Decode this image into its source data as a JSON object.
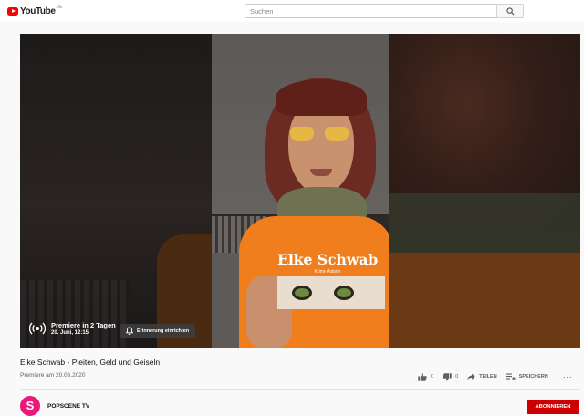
{
  "header": {
    "logo_text": "YouTube",
    "region": "DE",
    "search_placeholder": "Suchen"
  },
  "player": {
    "premiere_title": "Premiere in 2 Tagen",
    "premiere_date": "20. Juni, 12:15",
    "reminder_label": "Erinnerung einrichten",
    "shirt_text": "Elke Schwab",
    "shirt_subtext": "Krimi-Autorin"
  },
  "video": {
    "title": "Elke Schwab - Pleiten, Geld und Geiseln",
    "premiere_info": "Premiere am 20.06.2020",
    "likes": "0",
    "dislikes": "0",
    "share_label": "TEILEN",
    "save_label": "SPEICHERN",
    "more_label": "···"
  },
  "channel": {
    "avatar_letter": "S",
    "name": "POPSCENE TV",
    "subscribe_label": "ABONNIEREN"
  },
  "colors": {
    "brand_red": "#ff0000",
    "subscribe_red": "#cc0000",
    "avatar_pink": "#e8197a",
    "shirt_orange": "#f07e1d"
  }
}
